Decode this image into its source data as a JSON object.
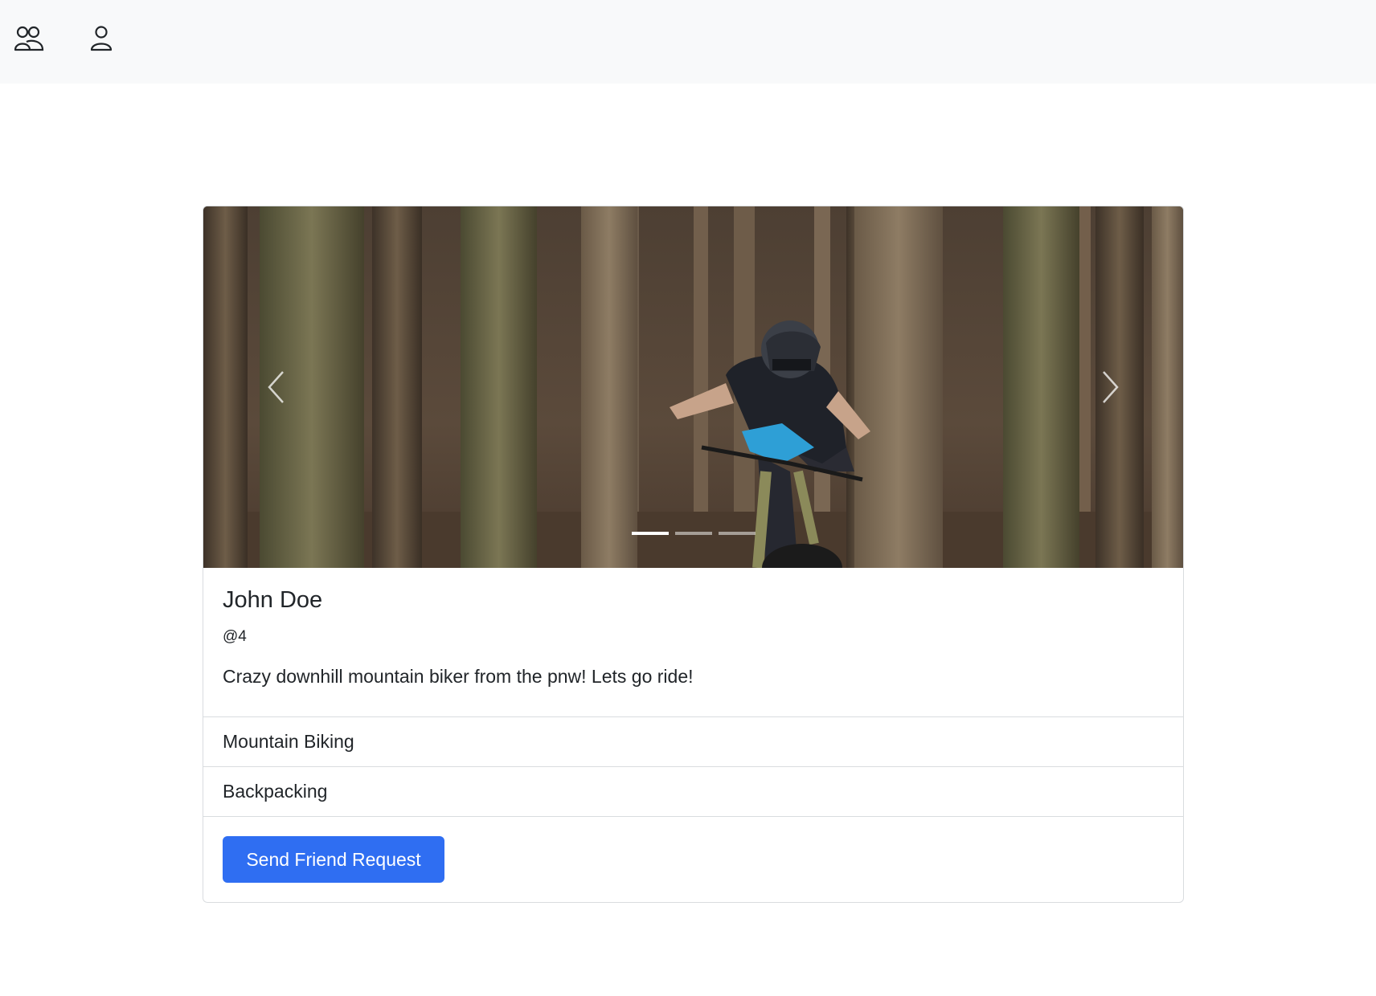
{
  "nav": {
    "items": [
      {
        "icon": "people-icon"
      },
      {
        "icon": "person-icon"
      }
    ]
  },
  "carousel": {
    "slide_count": 3,
    "active_index": 0,
    "prev_icon": "chevron-left-icon",
    "next_icon": "chevron-right-icon"
  },
  "profile": {
    "name": "John Doe",
    "handle": "@4",
    "bio": "Crazy downhill mountain biker from the pnw! Lets go ride!",
    "interests": [
      "Mountain Biking",
      "Backpacking"
    ],
    "action_label": "Send Friend Request"
  },
  "colors": {
    "primary": "#2f6ef2",
    "nav_bg": "#f8f9fa",
    "border": "#d9dcdf"
  }
}
